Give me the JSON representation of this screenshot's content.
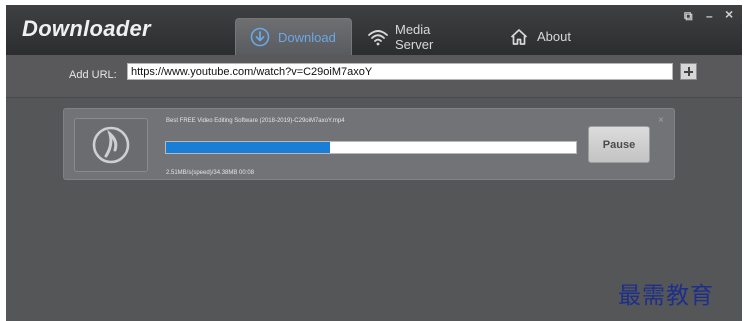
{
  "app": {
    "title": "Downloader"
  },
  "tabs": [
    {
      "label": "Download",
      "icon": "download-icon",
      "active": true
    },
    {
      "label": "Media Server",
      "icon": "wifi-icon",
      "active": false
    },
    {
      "label": "About",
      "icon": "home-icon",
      "active": false
    }
  ],
  "window_controls": {
    "restore": "⧉",
    "minimize": "–",
    "close": "×"
  },
  "url_bar": {
    "label": "Add URL:",
    "value": "https://www.youtube.com/watch?v=C29oiM7axoY"
  },
  "download": {
    "file_name": "Best FREE Video Editing Software (2018-2019)-C29oiM7axoY.mp4",
    "progress": 0.4,
    "speed_info": "2.51MB/s(speed)/34.38MB 00:08",
    "pause_label": "Pause",
    "close_symbol": "×"
  },
  "watermark": {
    "text": "最需教育"
  },
  "colors": {
    "accent": "#1a7ed6",
    "active_tab_text": "#6aa7e6",
    "header_bg": "#2c2d2f",
    "body_bg": "#555658",
    "card_bg": "#727376"
  }
}
